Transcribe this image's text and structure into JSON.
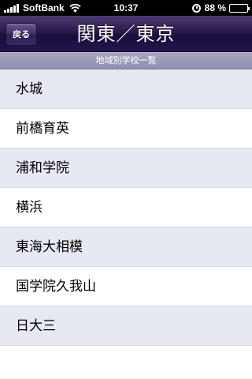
{
  "status_bar": {
    "carrier": "SoftBank",
    "time": "10:37",
    "battery_percent": "88 %",
    "battery_level": 0.88
  },
  "navbar": {
    "back_label": "戻る",
    "title": "関東／東京"
  },
  "section_header": "地域別学校一覧",
  "schools": [
    "水城",
    "前橋育英",
    "浦和学院",
    "横浜",
    "東海大相模",
    "国学院久我山",
    "日大三"
  ],
  "colors": {
    "navbar": "#24154a",
    "row_alt": "#e6e8f2"
  }
}
